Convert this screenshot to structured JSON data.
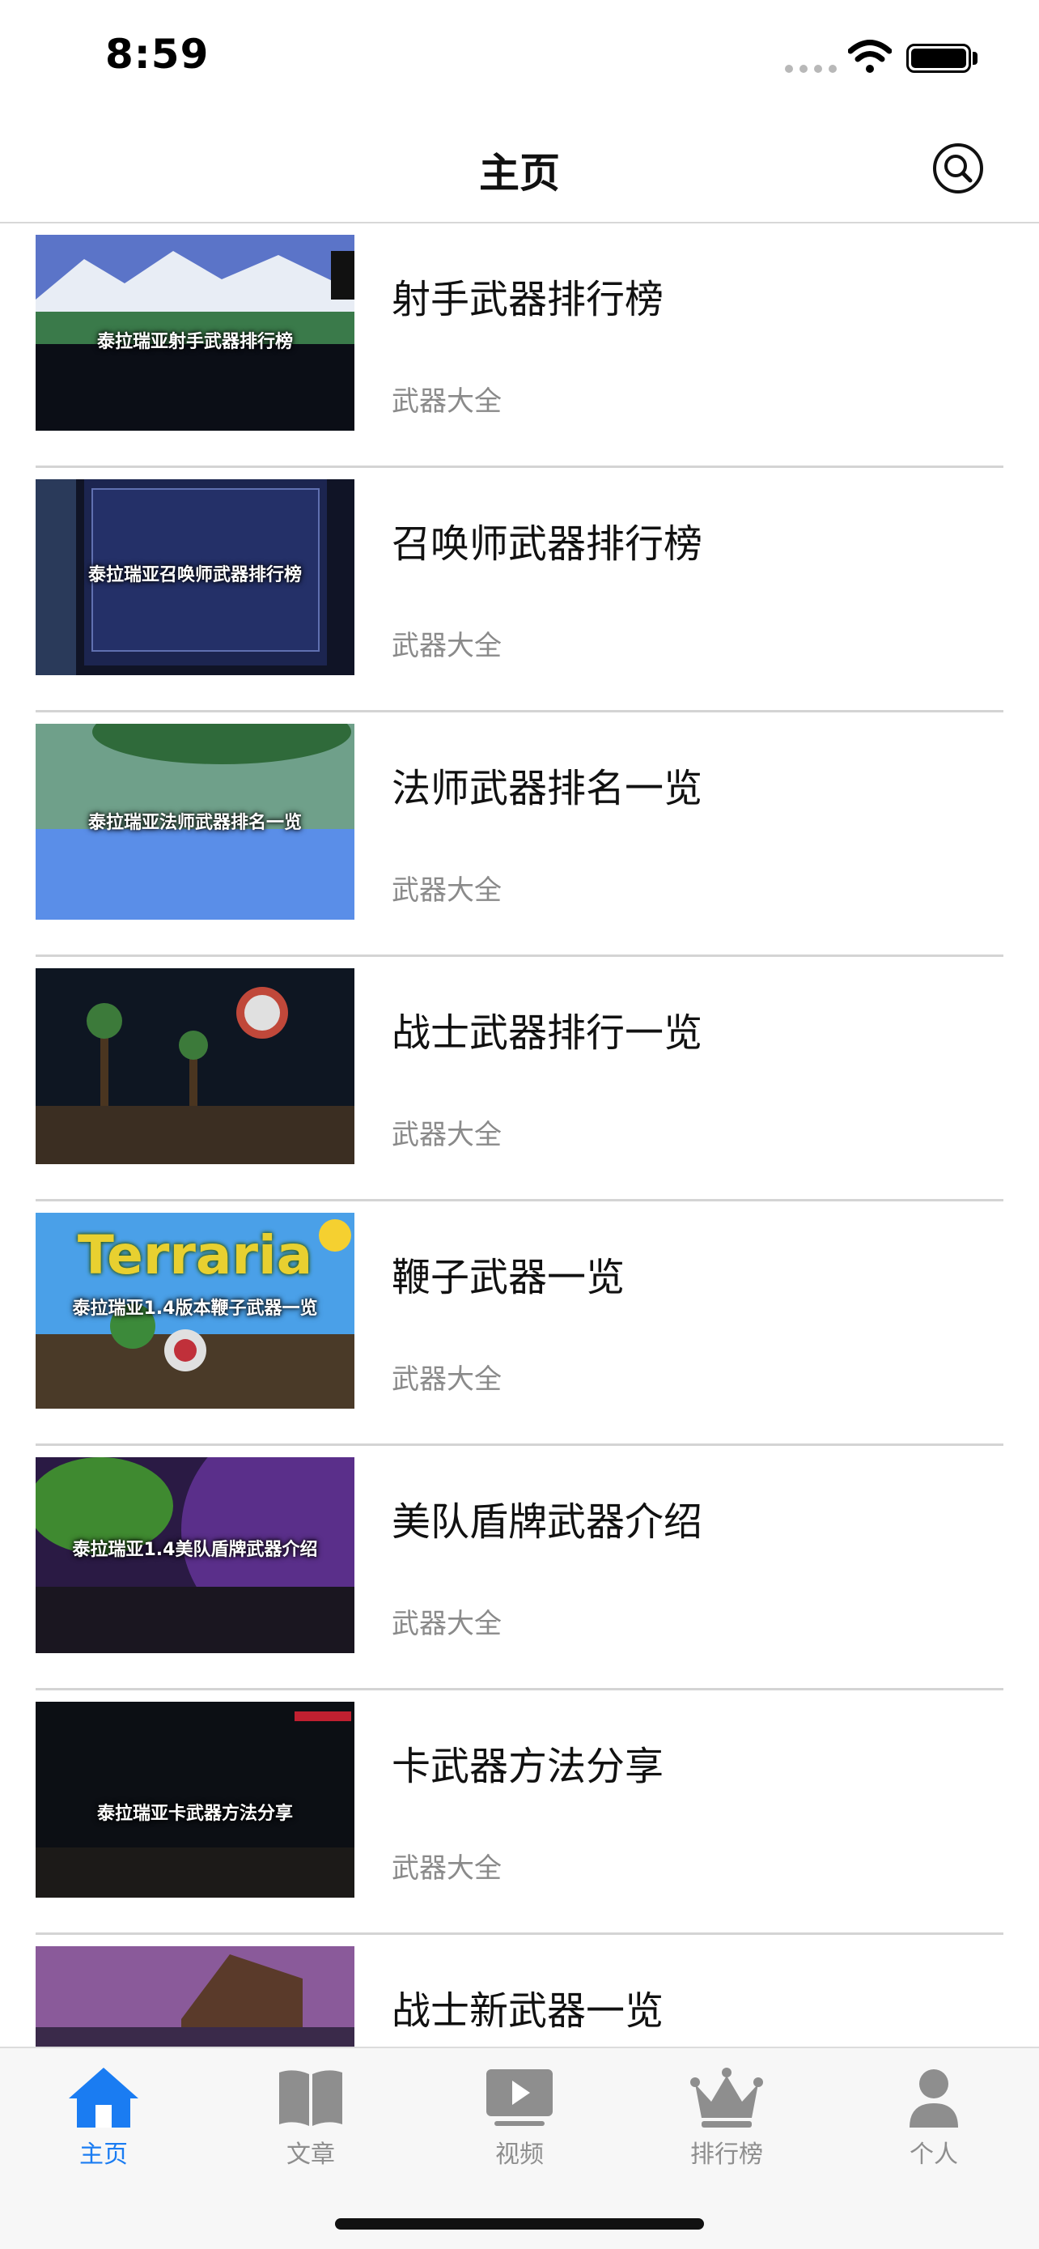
{
  "status_bar": {
    "time": "8:59"
  },
  "nav": {
    "title": "主页"
  },
  "list": [
    {
      "title": "射手武器排行榜",
      "subtitle": "武器大全",
      "caption": "泰拉瑞亚射手武器排行榜"
    },
    {
      "title": "召唤师武器排行榜",
      "subtitle": "武器大全",
      "caption": "泰拉瑞亚召唤师武器排行榜"
    },
    {
      "title": "法师武器排名一览",
      "subtitle": "武器大全",
      "caption": "泰拉瑞亚法师武器排名一览"
    },
    {
      "title": "战士武器排行一览",
      "subtitle": "武器大全",
      "caption": ""
    },
    {
      "title": "鞭子武器一览",
      "subtitle": "武器大全",
      "caption": "泰拉瑞亚1.4版本鞭子武器一览",
      "logo": "Terraria"
    },
    {
      "title": "美队盾牌武器介绍",
      "subtitle": "武器大全",
      "caption": "泰拉瑞亚1.4美队盾牌武器介绍"
    },
    {
      "title": "卡武器方法分享",
      "subtitle": "武器大全",
      "caption": "泰拉瑞亚卡武器方法分享"
    },
    {
      "title": "战士新武器一览",
      "subtitle": "",
      "caption": ""
    }
  ],
  "tabs": [
    {
      "label": "主页",
      "icon": "home-icon",
      "active": true
    },
    {
      "label": "文章",
      "icon": "book-icon",
      "active": false
    },
    {
      "label": "视频",
      "icon": "play-icon",
      "active": false
    },
    {
      "label": "排行榜",
      "icon": "crown-icon",
      "active": false
    },
    {
      "label": "个人",
      "icon": "person-icon",
      "active": false
    }
  ],
  "colors": {
    "accent": "#1a7cf2",
    "inactive": "#8e8e8e",
    "divider": "#d4d4d4"
  }
}
